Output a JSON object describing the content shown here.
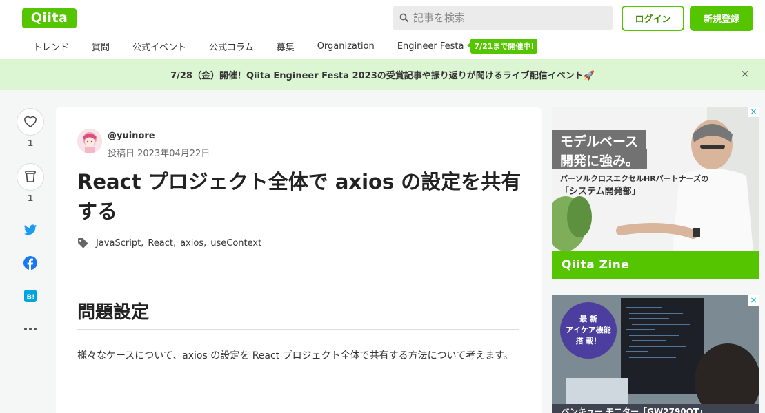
{
  "header": {
    "logo": "Qiita",
    "search_placeholder": "記事を検索",
    "login_label": "ログイン",
    "signup_label": "新規登録"
  },
  "nav": {
    "items": [
      "トレンド",
      "質問",
      "公式イベント",
      "公式コラム",
      "募集",
      "Organization",
      "Engineer Festa"
    ],
    "festa_badge": "7/21まで開催中!"
  },
  "banner": {
    "text": "7/28（金）開催！Qiita Engineer Festa 2023の受賞記事や振り返りが聞けるライブ配信イベント🚀",
    "close": "×"
  },
  "rail": {
    "like_count": "1",
    "stock_count": "1"
  },
  "article": {
    "author": "@yuinore",
    "posted": "投稿日 2023年04月22日",
    "title": "React プロジェクト全体で axios の設定を共有する",
    "tags": [
      "JavaScript",
      "React",
      "axios",
      "useContext"
    ],
    "heading": "問題設定",
    "paragraph": "様々なケースについて、axios の設定を React プロジェクト全体で共有する方法について考えます。"
  },
  "ads": {
    "ad1_line1": "モデルベース",
    "ad1_line2": "開発に強み。",
    "ad1_sub1": "パーソルクロスエクセルHRパートナーズの",
    "ad1_sub2": "「システム開発部」",
    "ad1_brand": "Qiita Zine",
    "ad2_circle": [
      "最 新",
      "アイケア機能",
      "搭 載！"
    ],
    "ad2_bottom": "ベンキュー モニター「GW2790QT」",
    "close_glyph": "×"
  },
  "colors": {
    "brand": "#55c500",
    "banner_bg": "#dcf6d4",
    "twitter": "#1d9bf0",
    "facebook": "#1877f2",
    "hatena": "#00a4de"
  }
}
